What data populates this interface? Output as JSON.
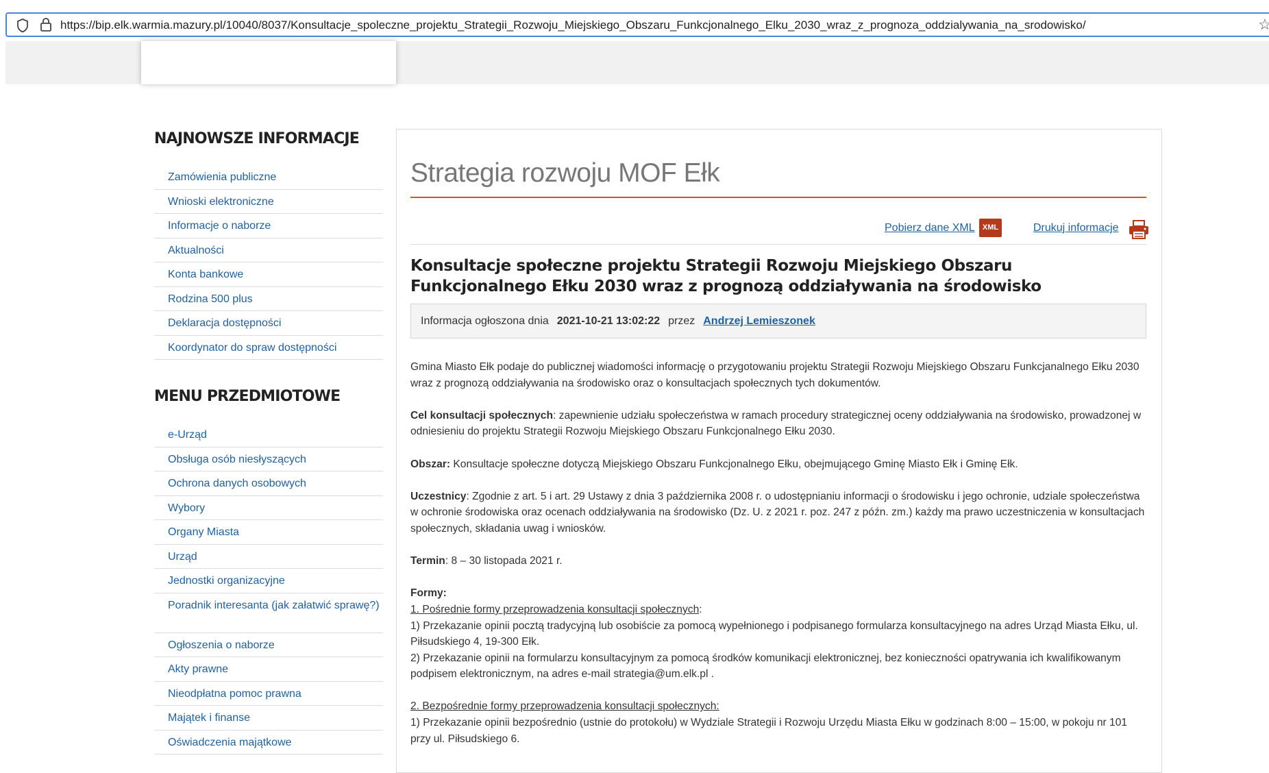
{
  "browser": {
    "url": "https://bip.elk.warmia.mazury.pl/10040/8037/Konsultacje_spoleczne_projektu_Strategii_Rozwoju_Miejskiego_Obszaru_Funkcjonalnego_Elku_2030_wraz_z_prognoza_oddzialywania_na_srodowisko/"
  },
  "sidebar": {
    "news_heading": "NAJNOWSZE INFORMACJE",
    "news_items": [
      {
        "label": "Zamówienia publiczne"
      },
      {
        "label": "Wnioski elektroniczne"
      },
      {
        "label": "Informacje o naborze"
      },
      {
        "label": "Aktualności"
      },
      {
        "label": "Konta bankowe"
      },
      {
        "label": "Rodzina 500 plus"
      },
      {
        "label": "Deklaracja dostępności"
      },
      {
        "label": "Koordynator do spraw dostępności"
      }
    ],
    "menu_heading": "MENU PRZEDMIOTOWE",
    "menu_items": [
      {
        "label": "e-Urząd"
      },
      {
        "label": "Obsługa osób niesłyszących"
      },
      {
        "label": "Ochrona danych osobowych"
      },
      {
        "label": "Wybory"
      },
      {
        "label": "Organy Miasta"
      },
      {
        "label": "Urząd"
      },
      {
        "label": "Jednostki organizacyjne"
      },
      {
        "label": "Poradnik interesanta (jak załatwić sprawę?)"
      },
      {
        "label": "Ogłoszenia o naborze"
      },
      {
        "label": "Akty prawne"
      },
      {
        "label": "Nieodpłatna pomoc prawna"
      },
      {
        "label": "Majątek i finanse"
      },
      {
        "label": "Oświadczenia majątkowe"
      }
    ]
  },
  "main": {
    "page_title": "Strategia rozwoju MOF Ełk",
    "xml_link": "Pobierz dane XML",
    "xml_badge": "XML",
    "print_link": "Drukuj informacje",
    "article_title": "Konsultacje społeczne projektu Strategii Rozwoju Miejskiego Obszaru Funkcjonalnego Ełku 2030 wraz z prognozą oddziaływania na środowisko",
    "meta": {
      "prefix": "Informacja ogłoszona dnia",
      "date": "2021-10-21 13:02:22",
      "by": "przez",
      "author": "Andrzej Lemieszonek"
    },
    "content": {
      "intro": "Gmina Miasto Ełk podaje do publicznej wiadomości informację o przygotowaniu projektu Strategii Rozwoju Miejskiego Obszaru Funkcjanalnego Ełku 2030 wraz z prognozą oddziaływania na środowisko oraz o konsultacjach społecznych tych dokumentów.",
      "cel_label": "Cel konsultacji społecznych",
      "cel_text": ": zapewnienie udziału społeczeństwa w ramach procedury strategicznej oceny oddziaływania na środowisko, prowadzonej w odniesieniu do projektu Strategii Rozwoju Miejskiego Obszaru Funkcjonalnego Ełku 2030.",
      "obszar_label": "Obszar:",
      "obszar_text": " Konsultacje społeczne dotyczą Miejskiego Obszaru Funkcjonalnego Ełku, obejmującego Gminę Miasto Ełk i Gminę Ełk.",
      "uczestnicy_label": "Uczestnicy",
      "uczestnicy_text": ": Zgodnie z art. 5 i art. 29 Ustawy z dnia 3 października 2008 r. o udostępnianiu informacji o środowisku i jego ochronie, udziale społeczeństwa w ochronie środowiska oraz ocenach oddziaływania na środowisko (Dz. U. z 2021 r. poz. 247 z późn. zm.) każdy ma prawo uczestniczenia w konsultacjach społecznych, składania uwag i wniosków.",
      "termin_label": "Termin",
      "termin_text": ": 8 – 30 listopada 2021 r.",
      "formy_label": "Formy:",
      "f1_heading": "1. Pośrednie formy przeprowadzenia konsultacji społecznych",
      "f1_heading_suffix": ":",
      "f1_item1": "1) Przekazanie opinii pocztą tradycyjną lub osobiście za pomocą wypełnionego i podpisanego formularza konsultacyjnego na adres Urząd Miasta Ełku, ul. Piłsudskiego 4, 19-300 Ełk.",
      "f1_item2": "2) Przekazanie opinii na formularzu konsultacyjnym za pomocą środków komunikacji elektronicznej, bez konieczności opatrywania ich kwalifikowanym podpisem elektronicznym, na adres e-mail strategia@um.elk.pl .",
      "f2_heading": "2. Bezpośrednie formy przeprowadzenia konsultacji społecznych:",
      "f2_item1": "1) Przekazanie opinii bezpośrednio (ustnie do protokołu) w Wydziale Strategii i Rozwoju Urzędu Miasta Ełku w godzinach 8:00 – 15:00, w pokoju nr 101 przy ul. Piłsudskiego 6."
    }
  }
}
